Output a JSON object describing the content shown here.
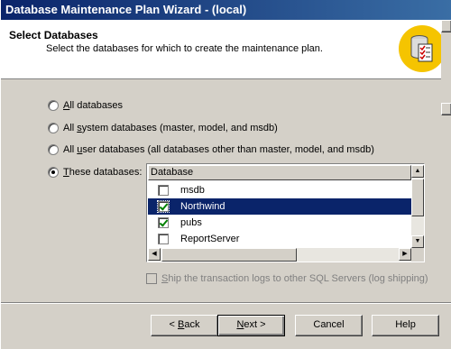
{
  "window": {
    "title": "Database Maintenance Plan Wizard - (local)"
  },
  "header": {
    "title": "Select Databases",
    "subtitle": "Select the databases for which to create the maintenance plan.",
    "icon": "database-checklist-icon"
  },
  "options": [
    {
      "pre": "",
      "accel": "A",
      "post": "ll databases",
      "checked": false
    },
    {
      "pre": "All ",
      "accel": "s",
      "post": "ystem databases (master, model, and msdb)",
      "checked": false
    },
    {
      "pre": "All ",
      "accel": "u",
      "post": "ser databases (all databases other than master, model, and msdb)",
      "checked": false
    },
    {
      "pre": "",
      "accel": "T",
      "post": "hese databases:",
      "checked": true
    }
  ],
  "database_list": {
    "header": "Database",
    "rows": [
      {
        "name": "msdb",
        "checked": false,
        "selected": false
      },
      {
        "name": "Northwind",
        "checked": true,
        "selected": true
      },
      {
        "name": "pubs",
        "checked": true,
        "selected": false
      },
      {
        "name": "ReportServer",
        "checked": false,
        "selected": false
      }
    ]
  },
  "ship_logs": {
    "pre": "",
    "accel": "S",
    "post": "hip the transaction logs to other SQL Servers (log shipping)",
    "enabled": false,
    "checked": false
  },
  "buttons": {
    "back": {
      "pre": "< ",
      "accel": "B",
      "post": "ack"
    },
    "next": {
      "pre": "",
      "accel": "N",
      "post": "ext >"
    },
    "cancel": "Cancel",
    "help": "Help"
  },
  "colors": {
    "titlebar": "#0a246a",
    "selection": "#0a246a",
    "icon_bg": "#f5c400"
  }
}
